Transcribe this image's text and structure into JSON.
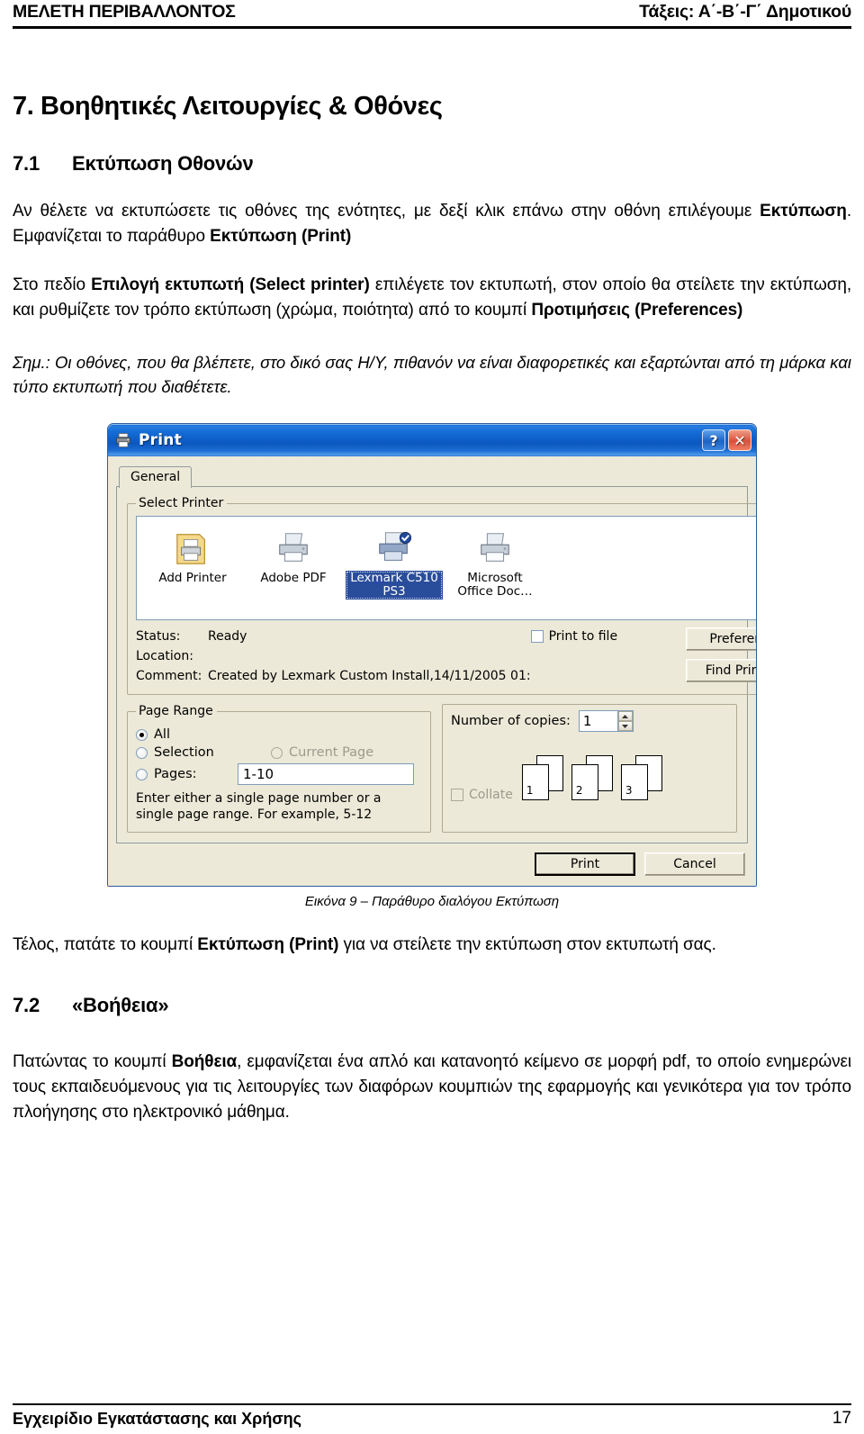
{
  "header": {
    "left": "ΜΕΛΕΤΗ ΠΕΡΙΒΑΛΛΟΝΤΟΣ",
    "right": "Τάξεις: Α΄-Β΄-Γ΄ Δημοτικού"
  },
  "headings": {
    "h1": "7. Βοηθητικές Λειτουργίες & Οθόνες",
    "h2_1_num": "7.1",
    "h2_1_text": "Εκτύπωση Οθονών",
    "h2_2_num": "7.2",
    "h2_2_text": "«Βοήθεια»"
  },
  "paragraphs": {
    "p1_a": "Αν θέλετε να εκτυπώσετε τις οθόνες της ενότητες, με δεξί κλικ επάνω στην οθόνη επιλέγουμε ",
    "p1_b": "Εκτύπωση",
    "p1_c": ". Εμφανίζεται το παράθυρο ",
    "p1_d": "Εκτύπωση (Print)",
    "p2_a": "Στο πεδίο ",
    "p2_b": "Επιλογή εκτυπωτή (Select printer)",
    "p2_c": " επιλέγετε τον εκτυπωτή, στον οποίο θα στείλετε την εκτύπωση, και ρυθμίζετε τον τρόπο εκτύπωση (χρώμα, ποιότητα) από το κουμπί ",
    "p2_d": "Προτιμήσεις (Preferences)",
    "note": "Σημ.: Οι οθόνες, που θα βλέπετε, στο δικό σας Η/Υ, πιθανόν να είναι διαφορετικές και εξαρτώνται από τη μάρκα και τύπο εκτυπωτή που διαθέτετε.",
    "caption": "Εικόνα 9 – Παράθυρο διαλόγου Εκτύπωση",
    "p3_a": "Τέλος, πατάτε το κουμπί ",
    "p3_b": "Εκτύπωση (Print)",
    "p3_c": " για να στείλετε την εκτύπωση στον εκτυπωτή σας.",
    "p4_a": "Πατώντας το κουμπί ",
    "p4_b": "Βοήθεια",
    "p4_c": ", εμφανίζεται ένα απλό και κατανοητό κείμενο σε μορφή pdf, το οποίο ενημερώνει τους εκπαιδευόμενους για τις λειτουργίες των διαφόρων κουμπιών της εφαρμογής και γενικότερα για τον τρόπο πλοήγησης στο ηλεκτρονικό μάθημα."
  },
  "dialog": {
    "title": "Print",
    "help_button": "?",
    "close_button": "✕",
    "tab_general": "General",
    "group_select_printer": "Select Printer",
    "printers": [
      {
        "name": "Add Printer",
        "selected": false,
        "is_default": false
      },
      {
        "name": "Adobe PDF",
        "selected": false,
        "is_default": false
      },
      {
        "name": "Lexmark C510 PS3",
        "selected": true,
        "is_default": true
      },
      {
        "name": "Microsoft Office Doc…",
        "selected": false,
        "is_default": false
      }
    ],
    "status_label": "Status:",
    "status_value": "Ready",
    "location_label": "Location:",
    "location_value": "",
    "comment_label": "Comment:",
    "comment_value": "Created by Lexmark Custom Install,14/11/2005 01:",
    "print_to_file_label": "Print to file",
    "print_to_file_checked": false,
    "preferences_button": "Preferences",
    "find_printer_button": "Find Printer...",
    "group_page_range": "Page Range",
    "radio_all": "All",
    "radio_selection": "Selection",
    "radio_current_page": "Current Page",
    "radio_pages": "Pages:",
    "selected_range": "all",
    "pages_value": "1-10",
    "pages_hint": "Enter either a single page number or a single page range.  For example, 5-12",
    "copies_label": "Number of copies:",
    "copies_value": "1",
    "collate_label": "Collate",
    "collate_checked": false,
    "collate_sheets": [
      "1",
      "1",
      "2",
      "2",
      "3",
      "3"
    ],
    "print_button": "Print",
    "cancel_button": "Cancel"
  },
  "footer": {
    "text": "Εγχειρίδιο Εγκατάστασης και Χρήσης",
    "page_number": "17"
  }
}
